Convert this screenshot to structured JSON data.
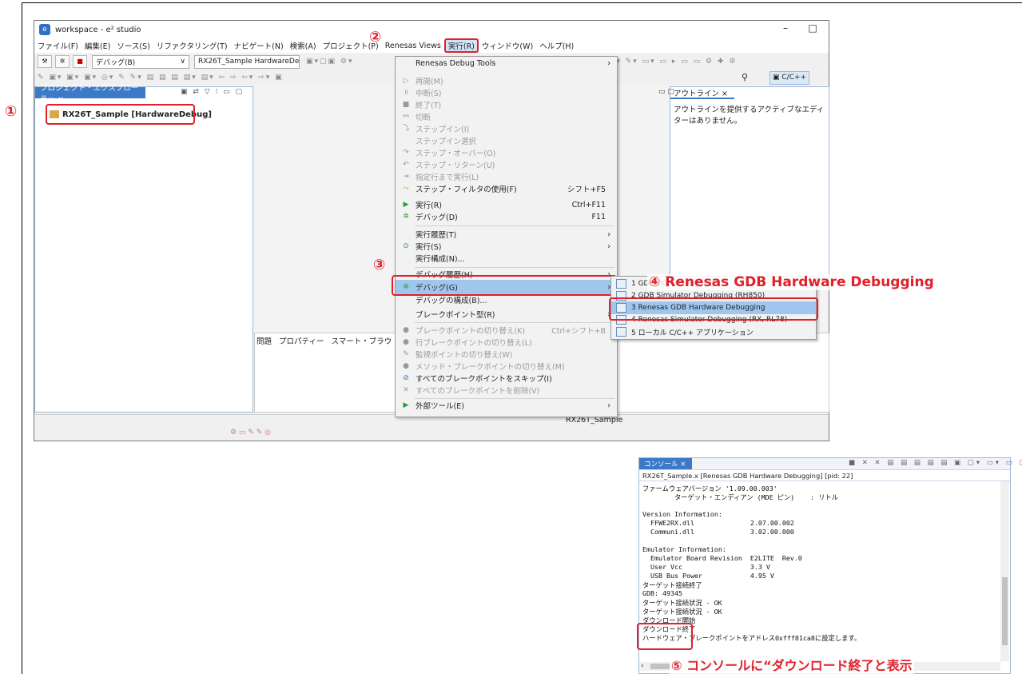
{
  "window": {
    "title": "workspace - e² studio",
    "minimize_glyph": "–",
    "maximize_glyph": "□"
  },
  "menubar": {
    "items": [
      "ファイル(F)",
      "編集(E)",
      "ソース(S)",
      "リファクタリング(T)",
      "ナビゲート(N)",
      "検索(A)",
      "プロジェクト(P)",
      "Renesas Views",
      "実行(R)",
      "ウィンドウ(W)",
      "ヘルプ(H)"
    ]
  },
  "toolbar": {
    "debug_label": "デバッグ(B)",
    "launch_config": "RX26T_Sample HardwareDe",
    "perspective": "C/C++"
  },
  "project_explorer": {
    "tab": "プロジェクト・エクスプローラー ×",
    "project": "RX26T_Sample [HardwareDebug]"
  },
  "outline": {
    "tab": "アウトライン ×",
    "message": "アウトラインを提供するアクティブなエディターはありません。"
  },
  "bottom_tabs": {
    "problems": "問題",
    "properties": "プロパティー",
    "smart": "スマート・ブラウ"
  },
  "status_bar": {
    "project": "RX26T_Sample"
  },
  "run_menu": {
    "items": [
      {
        "label": "Renesas Debug Tools",
        "shortcut": "",
        "arrow": ">",
        "disabled": false
      },
      {
        "label": "再開(M)",
        "shortcut": "",
        "disabled": true
      },
      {
        "label": "中断(S)",
        "shortcut": "",
        "disabled": true
      },
      {
        "label": "終了(T)",
        "shortcut": "",
        "disabled": true
      },
      {
        "label": "切断",
        "shortcut": "",
        "disabled": true
      },
      {
        "label": "ステップイン(I)",
        "shortcut": "",
        "disabled": true
      },
      {
        "label": "ステップイン選択",
        "shortcut": "",
        "disabled": true
      },
      {
        "label": "ステップ・オーバー(O)",
        "shortcut": "",
        "disabled": true
      },
      {
        "label": "ステップ・リターン(U)",
        "shortcut": "",
        "disabled": true
      },
      {
        "label": "指定行まで実行(L)",
        "shortcut": "",
        "disabled": true
      },
      {
        "label": "ステップ・フィルタの使用(F)",
        "shortcut": "シフト+F5",
        "disabled": false
      },
      {
        "label": "実行(R)",
        "shortcut": "Ctrl+F11",
        "disabled": false
      },
      {
        "label": "デバッグ(D)",
        "shortcut": "F11",
        "disabled": false
      },
      {
        "label": "実行履歴(T)",
        "shortcut": "",
        "arrow": ">",
        "disabled": false
      },
      {
        "label": "実行(S)",
        "shortcut": "",
        "arrow": ">",
        "disabled": false
      },
      {
        "label": "実行構成(N)...",
        "shortcut": "",
        "disabled": false
      },
      {
        "label": "デバッグ履歴(H)",
        "shortcut": "",
        "arrow": ">",
        "disabled": false
      },
      {
        "label": "デバッグ(G)",
        "shortcut": "",
        "arrow": ">",
        "disabled": false
      },
      {
        "label": "デバッグの構成(B)...",
        "shortcut": "",
        "disabled": false
      },
      {
        "label": "ブレークポイント型(R)",
        "shortcut": "",
        "arrow": ">",
        "disabled": false
      },
      {
        "label": "ブレークポイントの切り替え(K)",
        "shortcut": "Ctrl+シフト+B",
        "disabled": true
      },
      {
        "label": "行ブレークポイントの切り替え(L)",
        "shortcut": "",
        "disabled": true
      },
      {
        "label": "監視ポイントの切り替え(W)",
        "shortcut": "",
        "disabled": true
      },
      {
        "label": "メソッド・ブレークポイントの切り替え(M)",
        "shortcut": "",
        "disabled": true
      },
      {
        "label": "すべてのブレークポイントをスキップ(I)",
        "shortcut": "",
        "disabled": false
      },
      {
        "label": "すべてのブレークポイントを削除(V)",
        "shortcut": "",
        "disabled": true
      },
      {
        "label": "外部ツール(E)",
        "shortcut": "",
        "arrow": ">",
        "disabled": false
      }
    ]
  },
  "debug_submenu": {
    "items": [
      "1 GDB OCD Debugging",
      "2 GDB Simulator Debugging (RH850)",
      "3 Renesas GDB Hardware Debugging",
      "4 Renesas Simulator Debugging (RX, RL78)",
      "5 ローカル C/C++ アプリケーション"
    ]
  },
  "annotations": {
    "step1": "①",
    "step2": "②",
    "step3": "③",
    "step4": "④ Renesas GDB Hardware Debugging",
    "step5": "⑤ コンソールに“ダウンロード終了と表示"
  },
  "console": {
    "tab": "コンソール ×",
    "header": "RX26T_Sample.x [Renesas GDB Hardware Debugging]  [pid: 22]",
    "lines": [
      "ファームウェアバージョン '1.09.00.003'",
      "        ターゲット・エンディアン (MDE ピン)    : リトル",
      "",
      "Version Information:",
      "  FFWE2RX.dll              2.07.00.002",
      "  Communi.dll              3.02.00.000",
      "",
      "Emulator Information:",
      "  Emulator Board Revision  E2LITE  Rev.0",
      "  User Vcc                 3.3 V",
      "  USB Bus Power            4.95 V",
      "ターゲット接続終了",
      "GDB: 49345",
      "ターゲット接続状況 - OK",
      "ターゲット接続状況 - OK",
      "ダウンロード開始",
      "ダウンロード終了",
      "ハードウェア・ブレークポイントをアドレス0xfff81ca8に設定します。"
    ]
  }
}
